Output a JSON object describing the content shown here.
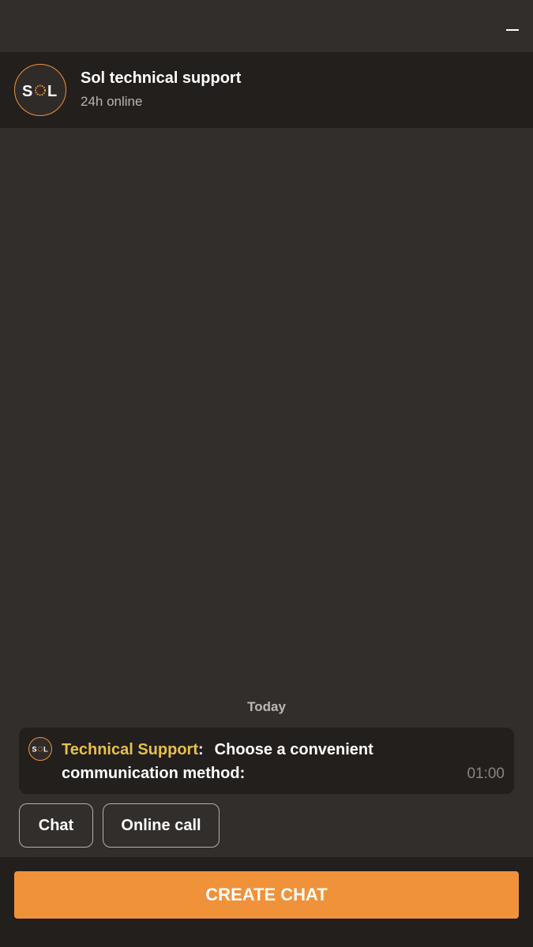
{
  "header": {
    "title": "Sol technical support",
    "status": "24h online",
    "logo_text": "SOL"
  },
  "window": {
    "minimize_icon": "minimize-icon"
  },
  "chat": {
    "date_separator": "Today",
    "messages": [
      {
        "sender": "Technical Support",
        "text": "Choose a convenient communication method:",
        "time": "01:00"
      }
    ],
    "quick_replies": [
      "Chat",
      "Online call"
    ]
  },
  "footer": {
    "create_button_label": "CREATE CHAT"
  },
  "colors": {
    "background": "#322e2b",
    "panel": "#221f1d",
    "accent": "#f0923a",
    "sender": "#e8c04a"
  }
}
